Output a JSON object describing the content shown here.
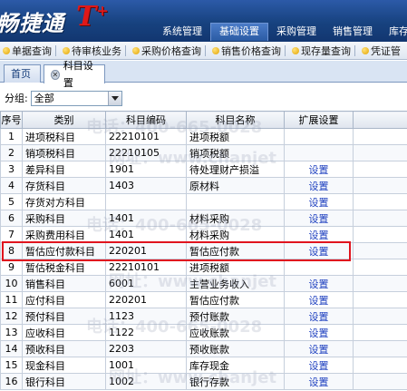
{
  "app": {
    "logo_text": "畅捷通",
    "logo_mark": "T",
    "logo_plus": "+",
    "accent_red": "#e01818",
    "banner_blue": "#17427f"
  },
  "top_menu": [
    {
      "label": "系统管理"
    },
    {
      "label": "基础设置"
    },
    {
      "label": "采购管理"
    },
    {
      "label": "销售管理"
    },
    {
      "label": "库存管"
    }
  ],
  "shortcuts": [
    {
      "label": "单据查询"
    },
    {
      "label": "待审核业务"
    },
    {
      "label": "采购价格查询"
    },
    {
      "label": "销售价格查询"
    },
    {
      "label": "现存量查询"
    },
    {
      "label": "凭证管"
    }
  ],
  "tabs": {
    "home": "首页",
    "settings": "科目设置"
  },
  "filter": {
    "label": "分组:",
    "selected": "全部"
  },
  "grid": {
    "columns": [
      "序号",
      "类别",
      "科目编码",
      "科目名称",
      "扩展设置"
    ],
    "rows": [
      {
        "idx": "1",
        "category": "进项税科目",
        "code": "22210101",
        "name": "进项税额",
        "ext": ""
      },
      {
        "idx": "2",
        "category": "销项税科目",
        "code": "22210105",
        "name": "销项税额",
        "ext": ""
      },
      {
        "idx": "3",
        "category": "差异科目",
        "code": "1901",
        "name": "待处理财产损溢",
        "ext": "设置"
      },
      {
        "idx": "4",
        "category": "存货科目",
        "code": "1403",
        "name": "原材料",
        "ext": "设置"
      },
      {
        "idx": "5",
        "category": "存货对方科目",
        "code": "",
        "name": "",
        "ext": "设置"
      },
      {
        "idx": "6",
        "category": "采购科目",
        "code": "1401",
        "name": "材料采购",
        "ext": "设置"
      },
      {
        "idx": "7",
        "category": "采购费用科目",
        "code": "1401",
        "name": "材料采购",
        "ext": "设置"
      },
      {
        "idx": "8",
        "category": "暂估应付款科目",
        "code": "220201",
        "name": "暂估应付款",
        "ext": "设置"
      },
      {
        "idx": "9",
        "category": "暂估税金科目",
        "code": "22210101",
        "name": "进项税额",
        "ext": ""
      },
      {
        "idx": "10",
        "category": "销售科目",
        "code": "6001",
        "name": "主营业务收入",
        "ext": "设置"
      },
      {
        "idx": "11",
        "category": "应付科目",
        "code": "220201",
        "name": "暂估应付款",
        "ext": "设置"
      },
      {
        "idx": "12",
        "category": "预付科目",
        "code": "1123",
        "name": "预付账款",
        "ext": "设置"
      },
      {
        "idx": "13",
        "category": "应收科目",
        "code": "1122",
        "name": "应收账款",
        "ext": "设置"
      },
      {
        "idx": "14",
        "category": "预收科目",
        "code": "2203",
        "name": "预收账款",
        "ext": "设置"
      },
      {
        "idx": "15",
        "category": "现金科目",
        "code": "1001",
        "name": "库存现金",
        "ext": "设置"
      },
      {
        "idx": "16",
        "category": "银行科目",
        "code": "1002",
        "name": "银行存款",
        "ext": "设置"
      }
    ],
    "highlighted_row": "8"
  },
  "watermark": {
    "phone": "电话：400-665-0028",
    "site": "网址：www.chanjet"
  }
}
